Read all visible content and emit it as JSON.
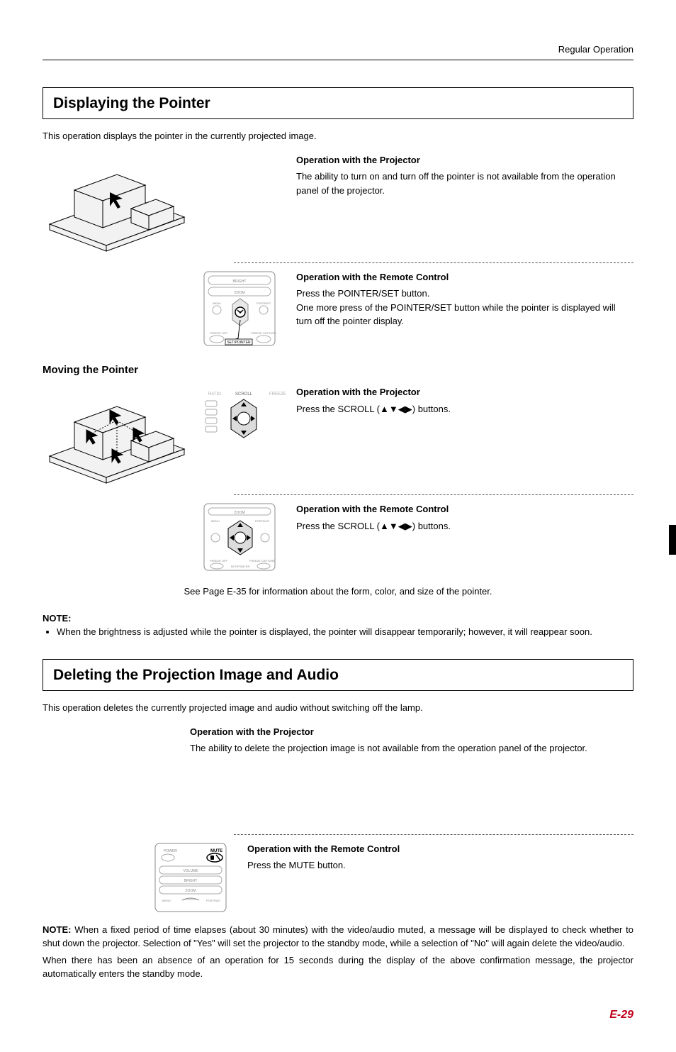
{
  "header": {
    "chapter": "Regular Operation"
  },
  "section1": {
    "title": "Displaying the Pointer",
    "intro": "This operation displays the pointer in the currently projected image.",
    "proj_head": "Operation with the Projector",
    "proj_body": "The ability to turn on and turn off the pointer is not available from the operation panel of the projector.",
    "remote_head": "Operation with the Remote Control",
    "remote_body1": "Press the POINTER/SET button.",
    "remote_body2": "One more press of the POINTER/SET button while the pointer is displayed will turn off the pointer display."
  },
  "moving": {
    "title": "Moving the Pointer",
    "proj_head": "Operation with the Projector",
    "proj_body_pre": "Press the SCROLL (",
    "arrows": "▲▼◀▶",
    "proj_body_post": ") buttons.",
    "remote_head": "Operation with the Remote Control",
    "remote_body_pre": "Press the SCROLL (",
    "remote_body_post": ") buttons.",
    "center_note": "See Page E-35 for information about the form, color, and size of the pointer."
  },
  "note1": {
    "label": "NOTE:",
    "bullet": "When the brightness is adjusted while the pointer is displayed, the pointer will disappear temporarily; however, it will reappear soon."
  },
  "section2": {
    "title": "Deleting the Projection Image and Audio",
    "intro": "This operation deletes the currently projected image and audio without switching off the lamp.",
    "proj_head": "Operation with the Projector",
    "proj_body": "The ability to delete the projection image is not available from the operation panel of the projector.",
    "remote_head": "Operation with the Remote Control",
    "remote_body": "Press the MUTE button."
  },
  "note2": {
    "label": "NOTE:",
    "p1": " When a fixed period of time elapses (about 30 minutes) with the video/audio muted, a message will be displayed to check whether to shut down the projector. Selection of \"Yes\" will set the projector to the standby mode, while a selection of \"No\" will again delete the video/audio.",
    "p2": "When there has been an absence of an operation for 15 seconds during the display of the above confirmation message, the projector automatically enters the standby mode."
  },
  "page_number": "E-29",
  "remote_labels": {
    "bright": "BRIGHT",
    "zoom": "ZOOM",
    "volume": "VOLUME",
    "menu": "MENU",
    "portrait": "PORTRAIT",
    "freeze_off": "FREEZE OFF",
    "freeze_capture": "FREEZE CAPTURE",
    "set_pointer": "SET/POINTER",
    "scroll": "SCROLL",
    "power": "POWER",
    "mute": "MUTE",
    "ratio": "RATIO",
    "freeze": "FREEZE"
  }
}
